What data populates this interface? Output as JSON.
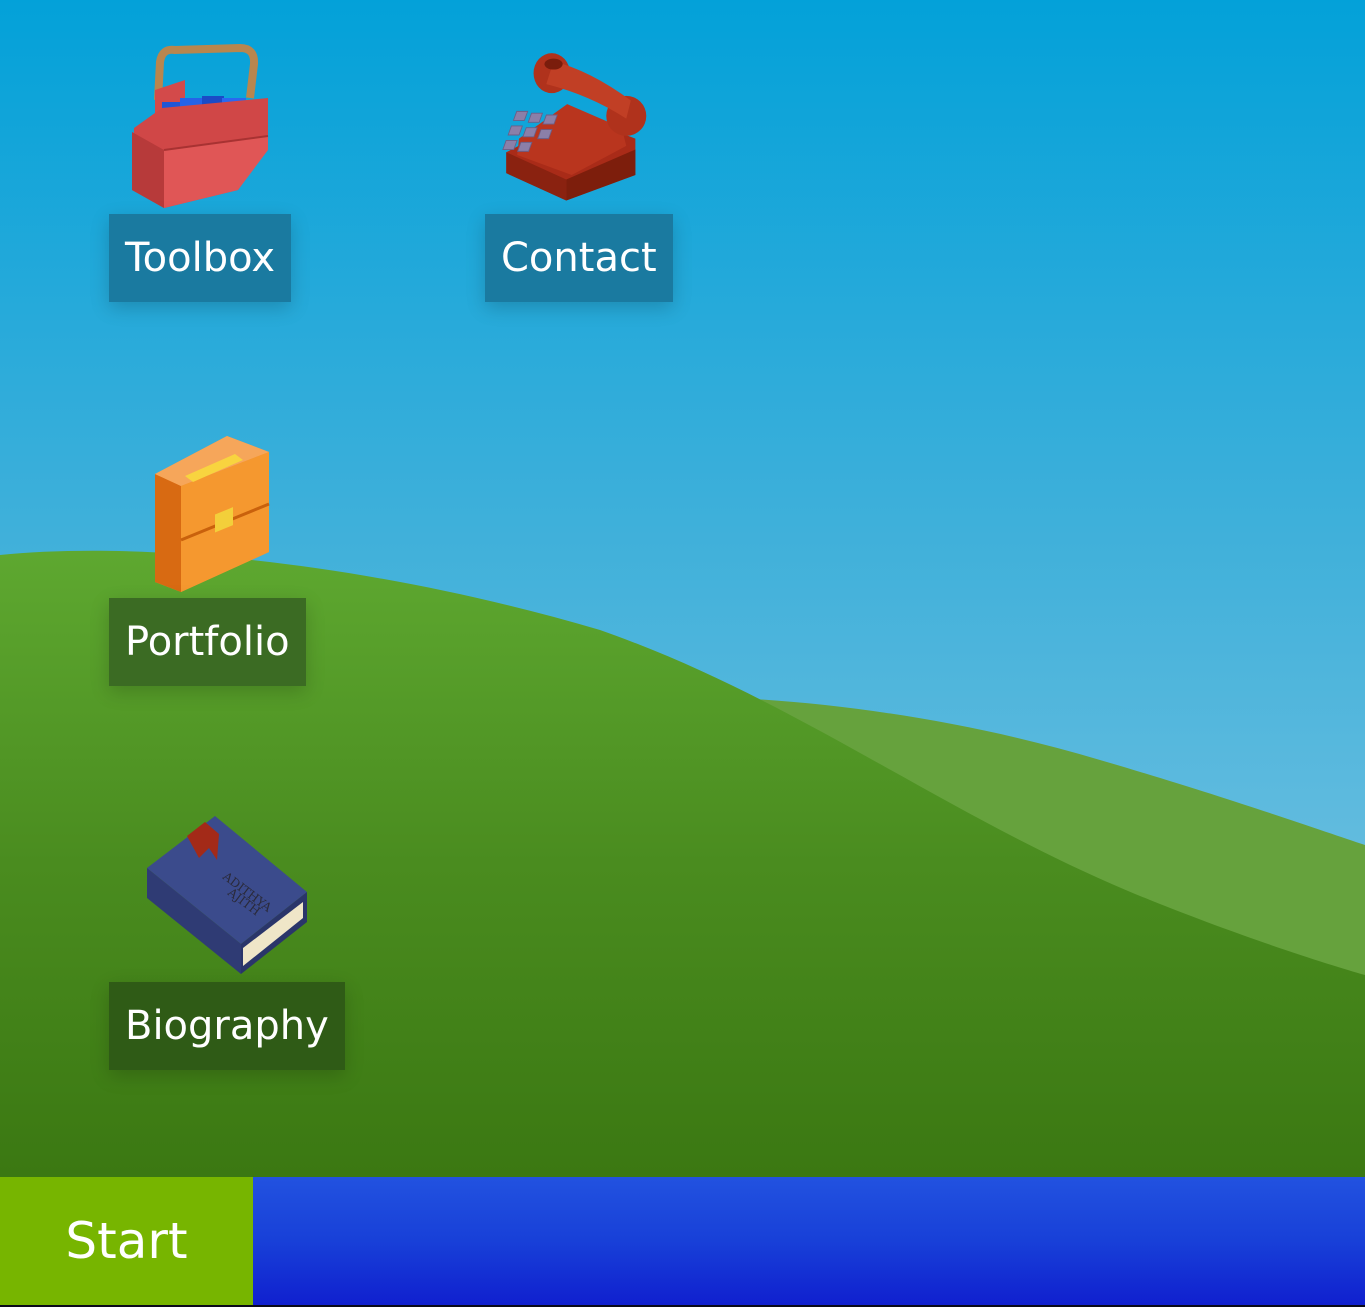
{
  "desktop": {
    "icons": [
      {
        "label": "Toolbox",
        "icon": "toolbox-icon"
      },
      {
        "label": "Contact",
        "icon": "telephone-icon"
      },
      {
        "label": "Portfolio",
        "icon": "briefcase-icon"
      },
      {
        "label": "Biography",
        "icon": "book-icon",
        "book_cover_text": "Adithya Ajith"
      }
    ]
  },
  "taskbar": {
    "start_label": "Start"
  },
  "colors": {
    "sky_top": "#03a1d9",
    "grass": "#4a8b1e",
    "start_button": "#77b500",
    "taskbar": "#1a3fd8"
  }
}
